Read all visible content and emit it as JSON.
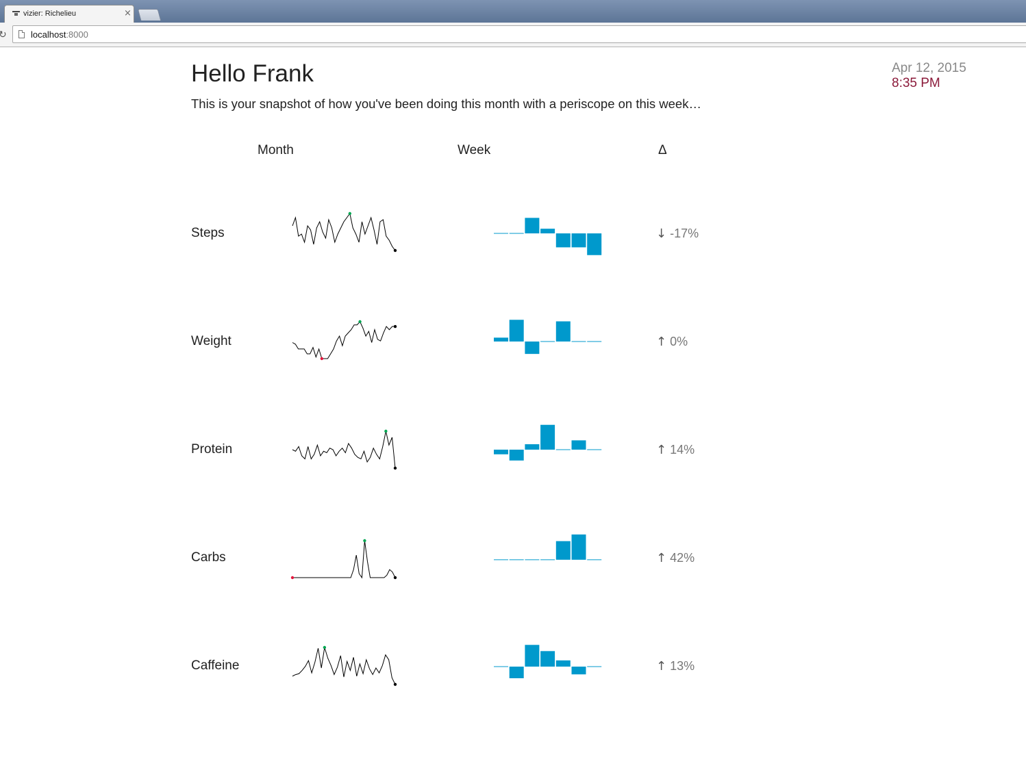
{
  "browser": {
    "tab_title": "vizier: Richelieu",
    "tab_close": "×",
    "reload_glyph": "↻",
    "url_host": "localhost",
    "url_port": ":8000"
  },
  "header": {
    "greeting": "Hello Frank",
    "subtitle": "This is your snapshot of how you've been doing this month with a periscope on this week…",
    "date": "Apr 12, 2015",
    "time": "8:35 PM"
  },
  "columns": {
    "month": "Month",
    "week": "Week",
    "delta": "Δ"
  },
  "colors": {
    "bar": "#0099cc",
    "line": "#000000",
    "max_point": "#00a651",
    "min_point": "#e3173e",
    "last_point": "#000000",
    "time_text": "#8b1a3a"
  },
  "chart_data": [
    {
      "type": "line",
      "metric": "Steps",
      "series": [
        {
          "values": [
            12,
            16,
            7,
            8,
            4,
            12,
            10,
            3,
            11,
            14,
            9,
            6,
            15,
            11,
            4,
            8,
            11,
            14,
            16,
            18,
            11,
            8,
            4,
            14,
            8,
            12,
            16,
            10,
            3,
            14,
            15,
            7,
            5,
            2,
            0
          ]
        }
      ],
      "max_point": "green",
      "min_point": "none",
      "last_point": "black"
    },
    {
      "type": "bar",
      "metric": "Steps",
      "categories": [
        "1",
        "2",
        "3",
        "4",
        "5",
        "6",
        "7"
      ],
      "values": [
        0,
        0,
        1.0,
        0.3,
        -0.9,
        -0.9,
        -1.4
      ],
      "ylim": [
        -1.5,
        1.5
      ]
    },
    {
      "type": "line",
      "metric": "Steps",
      "delta": "-17%",
      "direction": "down",
      "arrow": "↓"
    },
    {
      "type": "line",
      "metric": "Weight",
      "series": [
        {
          "values": [
            10,
            9,
            6,
            6,
            6,
            3,
            3,
            7,
            1,
            6,
            0,
            0,
            0,
            3,
            6,
            11,
            14,
            8,
            14,
            16,
            18,
            21,
            21,
            23,
            19,
            14,
            17,
            10,
            18,
            12,
            11,
            16,
            20,
            18,
            20,
            20
          ]
        }
      ],
      "max_point": "green",
      "min_point": "red",
      "last_point": "black"
    },
    {
      "type": "bar",
      "metric": "Weight",
      "categories": [
        "1",
        "2",
        "3",
        "4",
        "5",
        "6",
        "7"
      ],
      "values": [
        0.25,
        1.4,
        -0.8,
        0,
        1.3,
        0,
        0
      ],
      "ylim": [
        -1.5,
        1.5
      ]
    },
    {
      "type": "line",
      "metric": "Weight",
      "delta": "0%",
      "direction": "up",
      "arrow": "↑"
    },
    {
      "type": "line",
      "metric": "Protein",
      "series": [
        {
          "values": [
            12,
            11,
            14,
            8,
            6,
            14,
            6,
            9,
            15,
            8,
            11,
            10,
            13,
            12,
            8,
            11,
            13,
            10,
            16,
            13,
            9,
            7,
            6,
            11,
            4,
            7,
            13,
            9,
            6,
            14,
            24,
            15,
            20,
            0
          ]
        }
      ],
      "max_point": "green",
      "min_point": "none",
      "last_point": "black"
    },
    {
      "type": "bar",
      "metric": "Protein",
      "categories": [
        "1",
        "2",
        "3",
        "4",
        "5",
        "6",
        "7"
      ],
      "values": [
        -0.3,
        -0.7,
        0.35,
        1.6,
        0,
        0.6,
        0
      ],
      "ylim": [
        -1.5,
        1.5
      ]
    },
    {
      "type": "line",
      "metric": "Protein",
      "delta": "14%",
      "direction": "up",
      "arrow": "↑"
    },
    {
      "type": "line",
      "metric": "Carbs",
      "series": [
        {
          "values": [
            0,
            0,
            0,
            0,
            0,
            0,
            0,
            0,
            0,
            0,
            0,
            0,
            0,
            0,
            0,
            0,
            0,
            0,
            0,
            0,
            0,
            0,
            10,
            28,
            5,
            0,
            46,
            20,
            0,
            0,
            0,
            0,
            0,
            0,
            3,
            10,
            7,
            0
          ]
        }
      ],
      "max_point": "green",
      "min_point": "red",
      "last_point": "black"
    },
    {
      "type": "bar",
      "metric": "Carbs",
      "categories": [
        "1",
        "2",
        "3",
        "4",
        "5",
        "6",
        "7"
      ],
      "values": [
        0,
        0,
        0,
        0,
        1.4,
        1.9,
        0
      ],
      "ylim": [
        -1.5,
        2.0
      ]
    },
    {
      "type": "line",
      "metric": "Carbs",
      "delta": "42%",
      "direction": "up",
      "arrow": "↑"
    },
    {
      "type": "line",
      "metric": "Caffeine",
      "series": [
        {
          "values": [
            10,
            12,
            13,
            17,
            22,
            29,
            14,
            27,
            44,
            20,
            45,
            32,
            23,
            12,
            21,
            35,
            9,
            28,
            17,
            33,
            10,
            25,
            13,
            30,
            19,
            12,
            20,
            14,
            23,
            36,
            30,
            8,
            0
          ]
        }
      ],
      "max_point": "green",
      "min_point": "none",
      "last_point": "black"
    },
    {
      "type": "bar",
      "metric": "Caffeine",
      "categories": [
        "1",
        "2",
        "3",
        "4",
        "5",
        "6",
        "7"
      ],
      "values": [
        0,
        -0.75,
        1.4,
        1.0,
        0.4,
        -0.5,
        0
      ],
      "ylim": [
        -1.5,
        1.5
      ]
    },
    {
      "type": "line",
      "metric": "Caffeine",
      "delta": "13%",
      "direction": "up",
      "arrow": "↑"
    }
  ],
  "rows": [
    {
      "label": "Steps",
      "delta_arrow": "↓",
      "delta_value": "-17%"
    },
    {
      "label": "Weight",
      "delta_arrow": "↑",
      "delta_value": "0%"
    },
    {
      "label": "Protein",
      "delta_arrow": "↑",
      "delta_value": "14%"
    },
    {
      "label": "Carbs",
      "delta_arrow": "↑",
      "delta_value": "42%"
    },
    {
      "label": "Caffeine",
      "delta_arrow": "↑",
      "delta_value": "13%"
    }
  ]
}
